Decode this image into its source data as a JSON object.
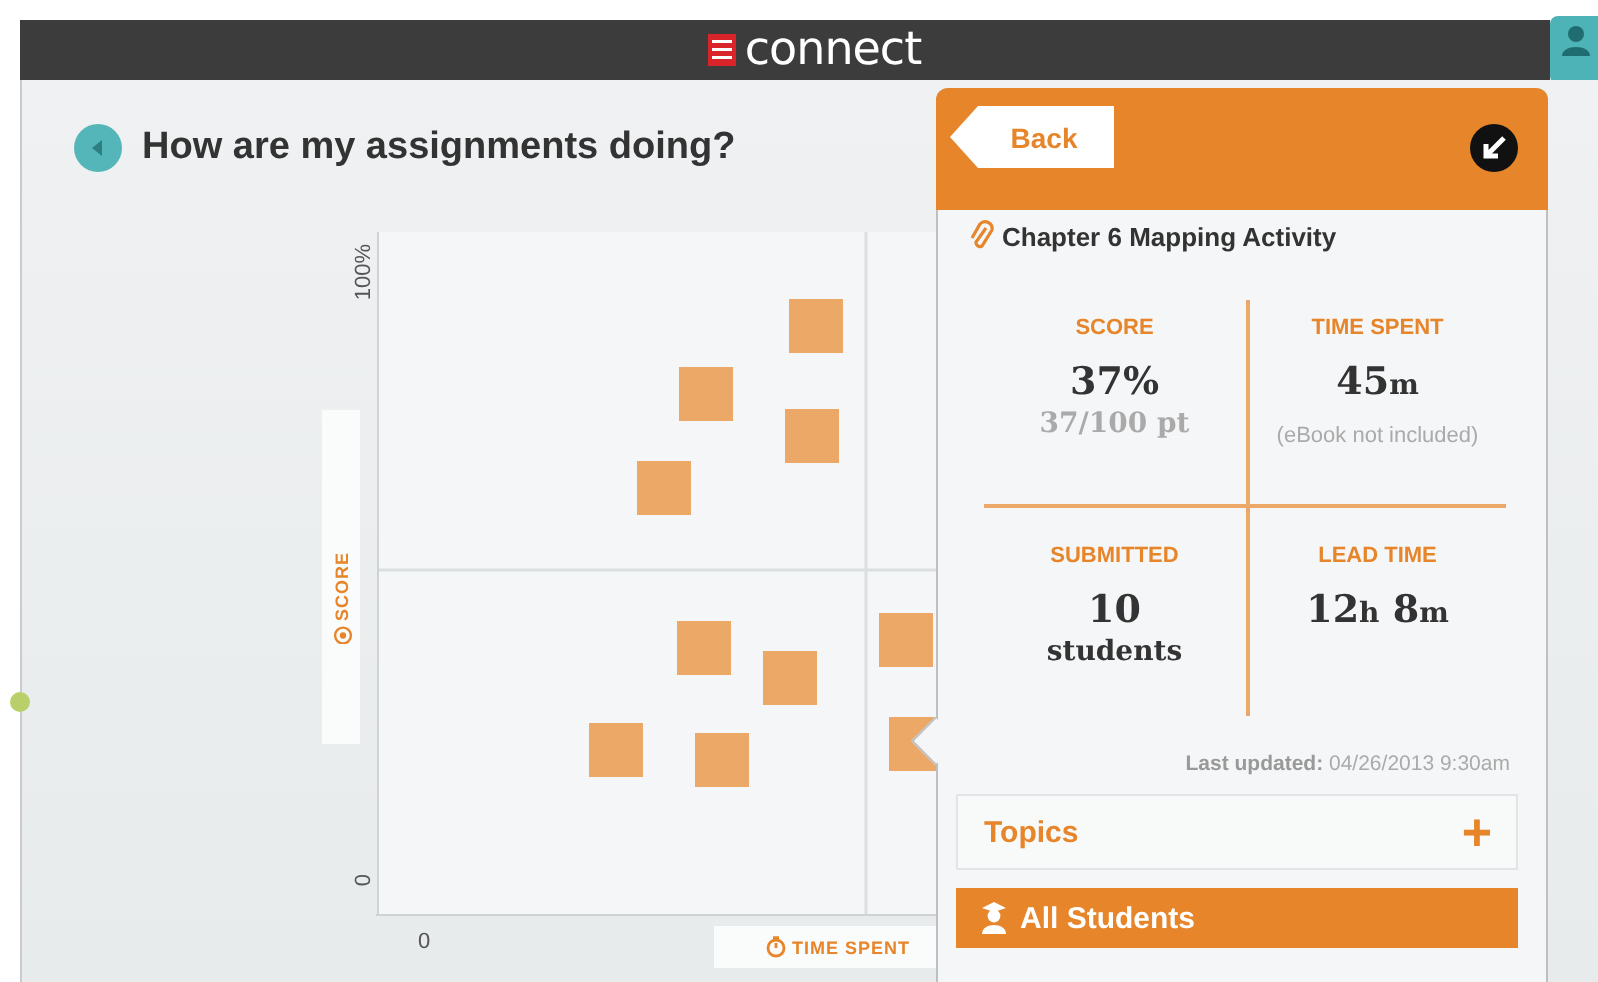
{
  "app_bar": {
    "brand": "connect"
  },
  "page": {
    "title": "How are my assignments doing?"
  },
  "chart": {
    "y_ticks": [
      "100%",
      "0"
    ],
    "x_ticks": [
      "0"
    ],
    "y_label": "SCORE",
    "x_label": "TIME SPENT"
  },
  "panel": {
    "back": "Back",
    "assignment": "Chapter 6 Mapping Activity",
    "stats": [
      {
        "label": "SCORE",
        "parts": [
          {
            "text": "37%",
            "kind": "number"
          }
        ],
        "sub": "37/100 pt",
        "kind": "serif"
      },
      {
        "label": "TIME SPENT",
        "parts": [
          {
            "text": "45",
            "kind": "number"
          },
          {
            "text": "m",
            "kind": "unit"
          }
        ],
        "sub": "(eBook not included)",
        "kind": "note"
      },
      {
        "label": "SUBMITTED",
        "parts": [
          {
            "text": "10",
            "kind": "number"
          }
        ],
        "sub": "students",
        "kind": "strong"
      },
      {
        "label": "LEAD TIME",
        "parts": [
          {
            "text": "12",
            "kind": "number"
          },
          {
            "text": "h",
            "kind": "unit"
          },
          {
            "text": " 8",
            "kind": "number"
          },
          {
            "text": "m",
            "kind": "unit"
          }
        ]
      }
    ],
    "updated": "**Last updated:** 04/26/2013 9:30am",
    "topics": {
      "label": "Topics",
      "toggle": "+",
      "expanded": false
    },
    "students": {
      "label": "All Students",
      "selected": true
    }
  }
}
